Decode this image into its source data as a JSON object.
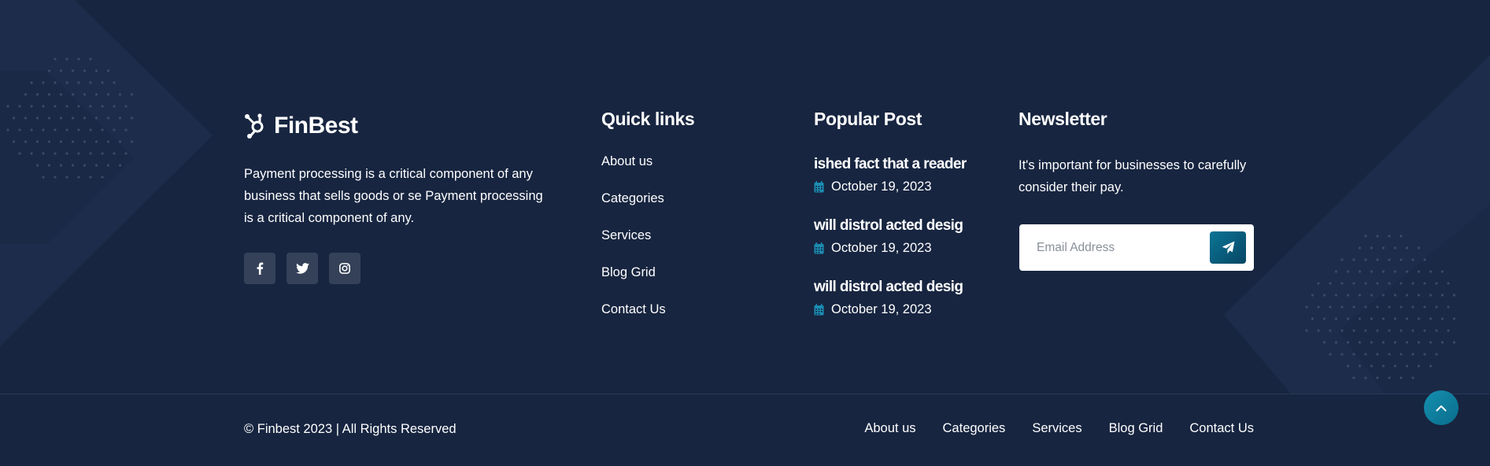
{
  "brand": {
    "name": "FinBest",
    "icon": "hub-network-icon"
  },
  "about": {
    "text": "Payment processing is a critical component of any business that sells goods or se Payment processing is a critical component of any."
  },
  "socials": [
    {
      "name": "facebook",
      "icon": "facebook-icon"
    },
    {
      "name": "twitter",
      "icon": "twitter-icon"
    },
    {
      "name": "instagram",
      "icon": "instagram-icon"
    }
  ],
  "quick_links": {
    "title": "Quick links",
    "items": [
      "About us",
      "Categories",
      "Services",
      "Blog Grid",
      "Contact Us"
    ]
  },
  "popular_post": {
    "title": "Popular Post",
    "posts": [
      {
        "title": "ished fact that a reader",
        "date": "October 19, 2023"
      },
      {
        "title": "will distrol acted desig",
        "date": "October 19, 2023"
      },
      {
        "title": "will distrol acted desig",
        "date": "October 19, 2023"
      }
    ]
  },
  "newsletter": {
    "title": "Newsletter",
    "text": "It's important for businesses to carefully consider their pay.",
    "placeholder": "Email Address",
    "submit_icon": "paper-plane-icon"
  },
  "footer_bottom": {
    "copyright": "© Finbest 2023 | All Rights Reserved",
    "links": [
      "About us",
      "Categories",
      "Services",
      "Blog Grid",
      "Contact Us"
    ]
  },
  "scroll_top": {
    "icon": "chevron-up-icon"
  },
  "colors": {
    "background": "#172540",
    "accent": "#0a6c8c",
    "date_icon": "#1b8db3",
    "social_bg": "#344158",
    "text": "#ffffff"
  }
}
